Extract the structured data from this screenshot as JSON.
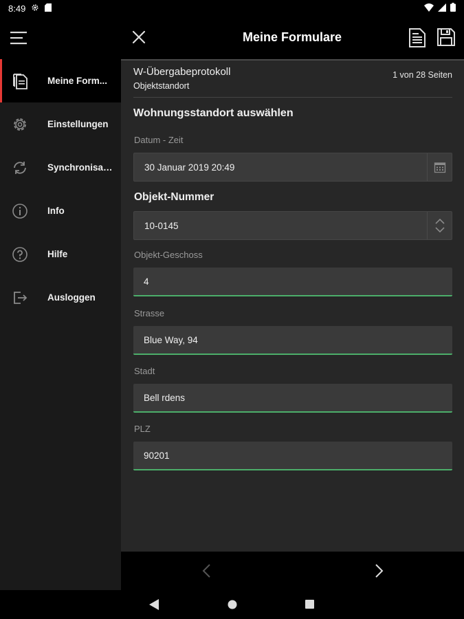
{
  "status": {
    "time": "8:49"
  },
  "app_bar": {
    "title": "Meine Formulare"
  },
  "sidebar": {
    "items": [
      {
        "label": "Meine Form...",
        "icon": "documents-icon",
        "active": true
      },
      {
        "label": "Einstellungen",
        "icon": "gear-icon"
      },
      {
        "label": "Synchronisat...",
        "icon": "sync-icon"
      },
      {
        "label": "Info",
        "icon": "info-icon"
      },
      {
        "label": "Hilfe",
        "icon": "help-icon"
      },
      {
        "label": "Ausloggen",
        "icon": "logout-icon"
      }
    ]
  },
  "form": {
    "title": "W-Übergabeprotokoll",
    "subtitle": "Objektstandort",
    "page_count": "1 von 28 Seiten",
    "section_title": "Wohnungsstandort auswählen",
    "fields": {
      "datum": {
        "label": "Datum - Zeit",
        "value": "30 Januar 2019 20:49"
      },
      "objekt_nummer": {
        "label": "Objekt-Nummer",
        "value": "10-0145"
      },
      "geschoss": {
        "label": "Objekt-Geschoss",
        "value": "4"
      },
      "strasse": {
        "label": "Strasse",
        "value": "Blue Way, 94"
      },
      "stadt": {
        "label": "Stadt",
        "value": "Bell rdens"
      },
      "plz": {
        "label": "PLZ",
        "value": "90201"
      }
    }
  },
  "colors": {
    "accent_active": "#e53935",
    "field_underline": "#4caf6a",
    "background": "#272727",
    "sidebar": "#1a1a1a"
  }
}
